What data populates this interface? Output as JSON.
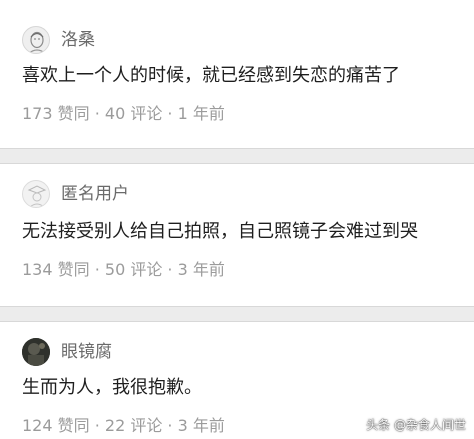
{
  "comments": [
    {
      "username": "洛桑",
      "avatar_icon": "sketch-portrait-avatar",
      "text": "喜欢上一个人的时候，就已经感到失恋的痛苦了",
      "meta": "173 赞同 · 40 评论 · 1 年前"
    },
    {
      "username": "匿名用户",
      "avatar_icon": "anonymous-user-avatar",
      "text": "无法接受别人给自己拍照，自己照镜子会难过到哭",
      "meta": "134 赞同 · 50 评论 · 3 年前"
    },
    {
      "username": "眼镜腐",
      "avatar_icon": "dark-photo-avatar",
      "text": "生而为人，我很抱歉。",
      "meta": "124 赞同 · 22 评论 · 3 年前"
    }
  ],
  "watermark": "头条 @杂食人间世",
  "colors": {
    "separator": "#ececec",
    "username": "#6a6a6a",
    "meta": "#9b9b9b",
    "text": "#1e1e1e"
  }
}
